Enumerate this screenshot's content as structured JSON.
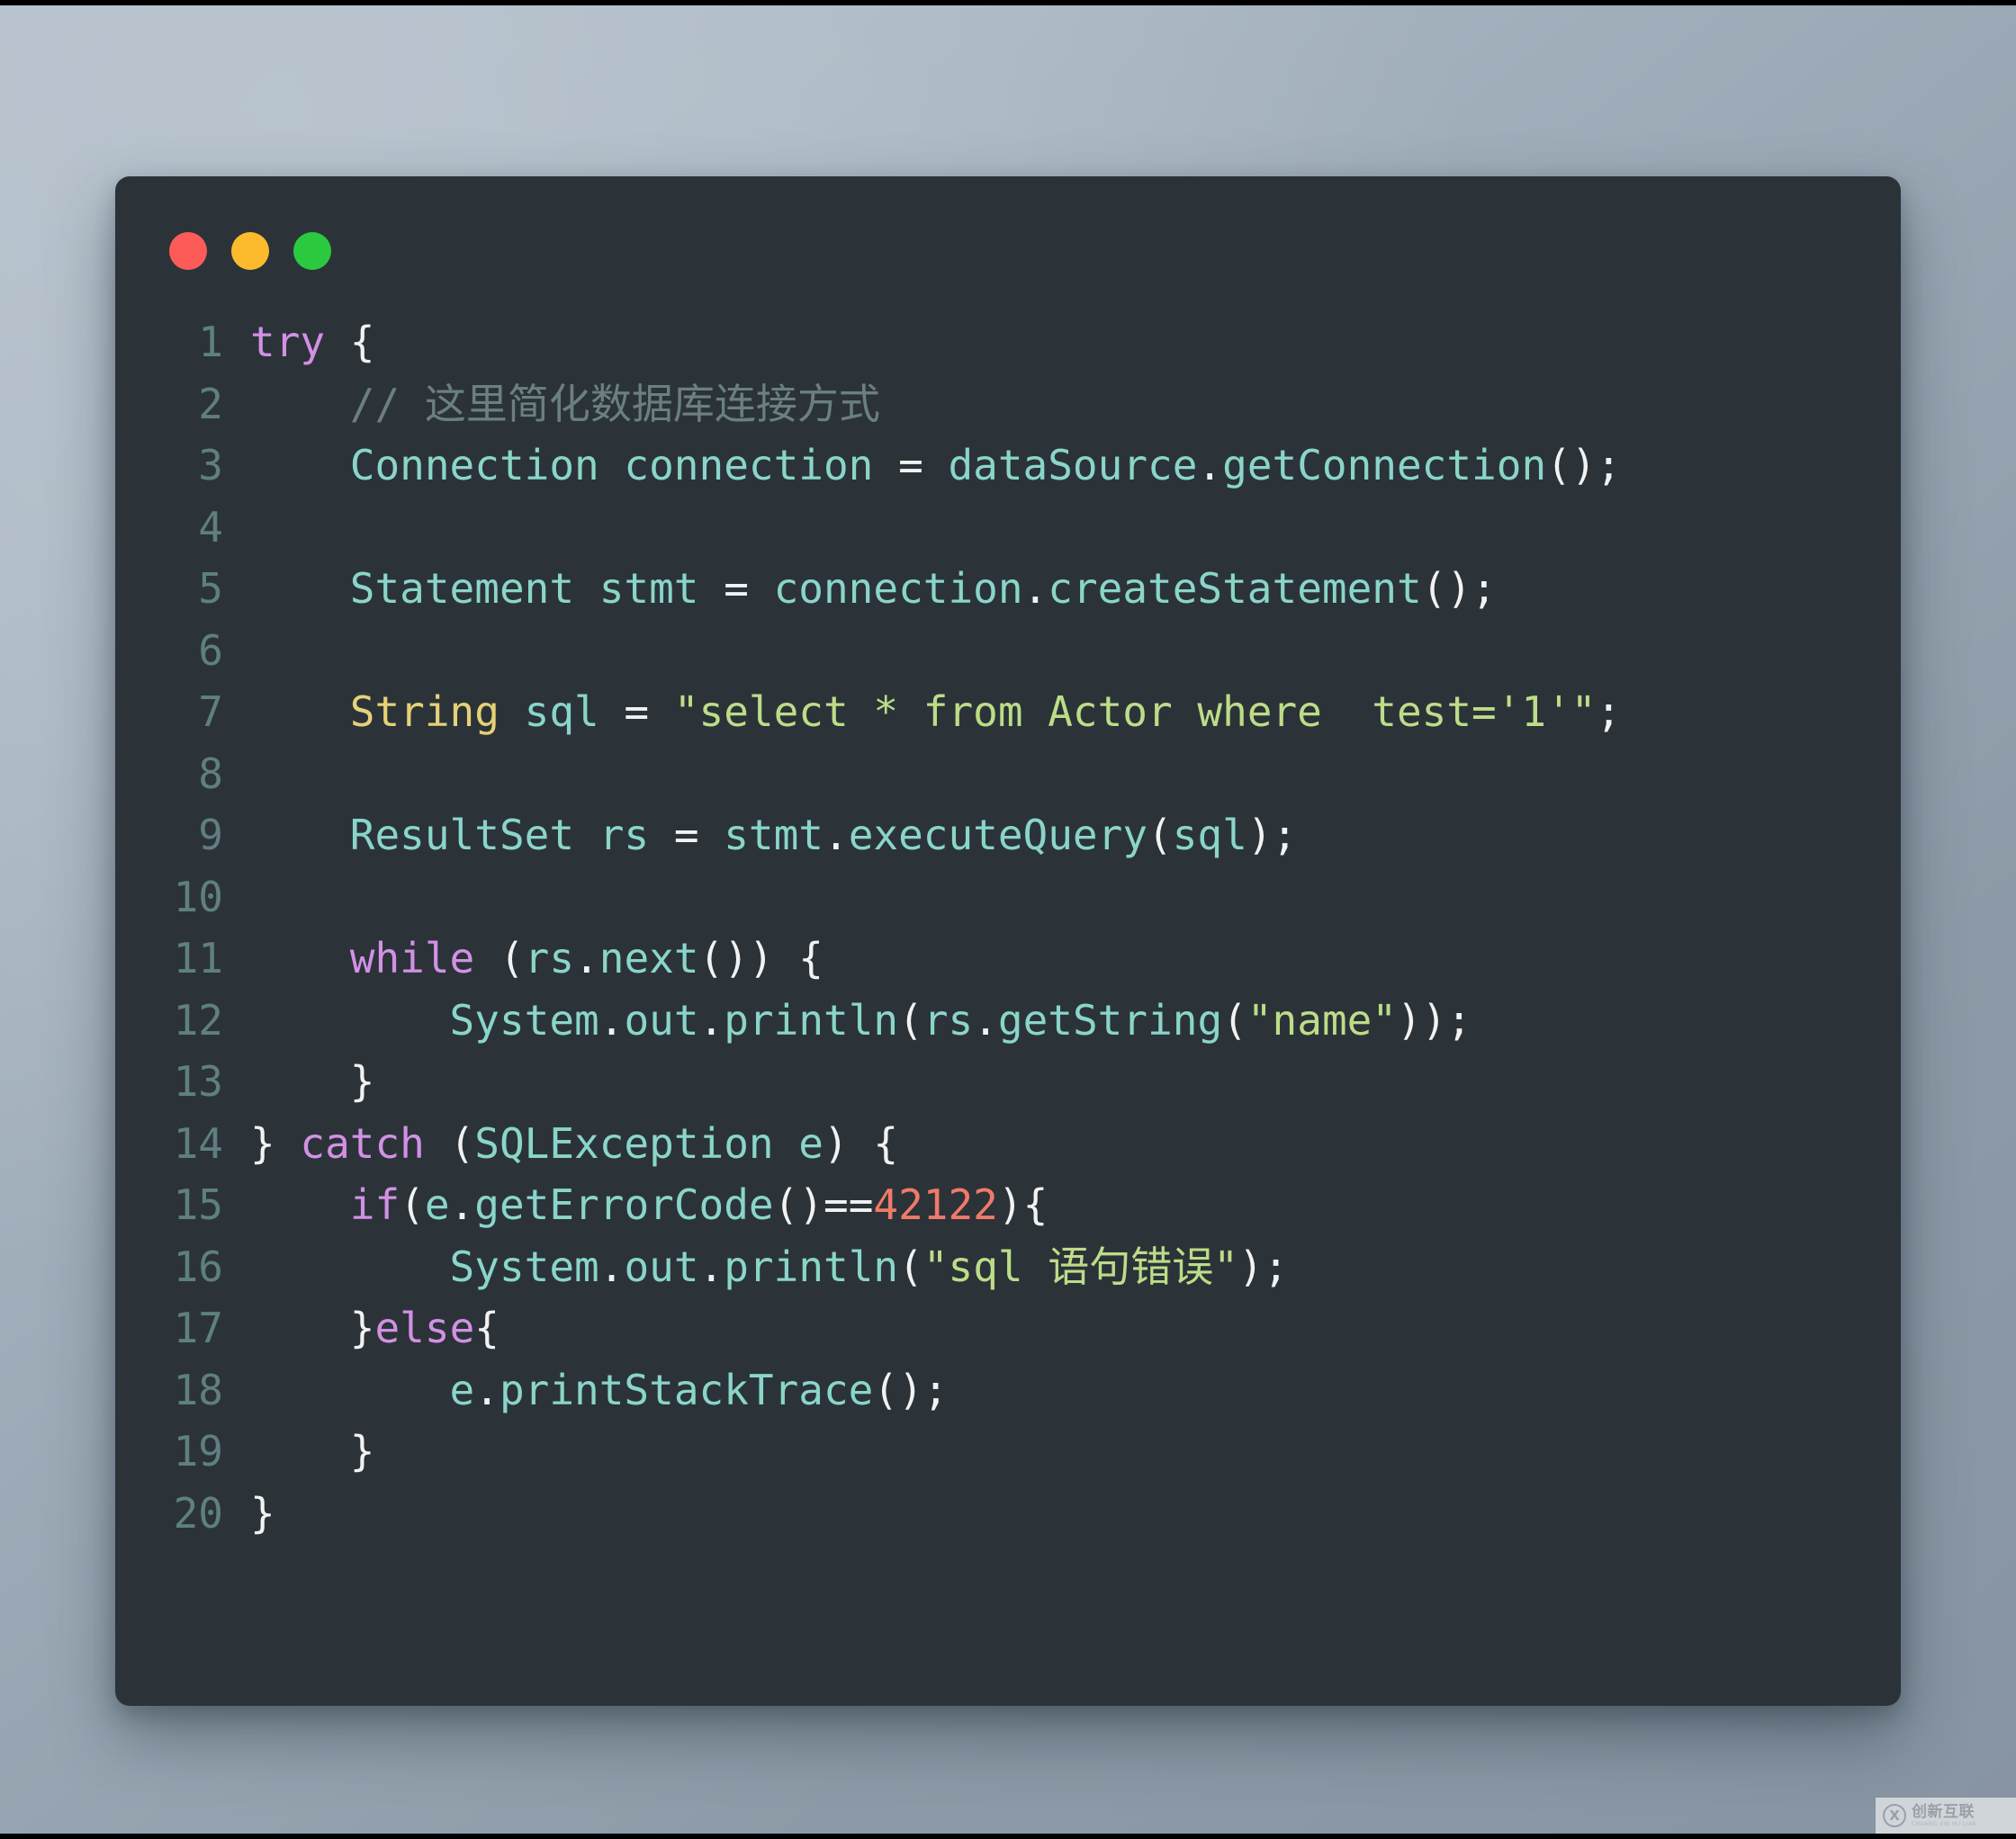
{
  "window": {
    "title": "",
    "traffic_lights": [
      {
        "name": "close",
        "color": "#fc5b57"
      },
      {
        "name": "minimize",
        "color": "#fcbb2d"
      },
      {
        "name": "maximize",
        "color": "#2bc93f"
      }
    ],
    "background": "#2b3339",
    "page_background": "#a0aeba"
  },
  "theme": {
    "plain": "#f2f2f2",
    "keyword": "#d291e4",
    "type": "#8ad5c9",
    "string": "#bddc88",
    "number": "#f07a6a",
    "comment": "#6b7f82",
    "yellow": "#e6d177",
    "line_number": "#5f7f80"
  },
  "code": {
    "language": "java",
    "line_numbers": [
      "1",
      "2",
      "3",
      "4",
      "5",
      "6",
      "7",
      "8",
      "9",
      "10",
      "11",
      "12",
      "13",
      "14",
      "15",
      "16",
      "17",
      "18",
      "19",
      "20"
    ],
    "lines": [
      {
        "n": "1",
        "text": "try {"
      },
      {
        "n": "2",
        "text": "    // 这里简化数据库连接方式"
      },
      {
        "n": "3",
        "text": "    Connection connection = dataSource.getConnection();"
      },
      {
        "n": "4",
        "text": ""
      },
      {
        "n": "5",
        "text": "    Statement stmt = connection.createStatement();"
      },
      {
        "n": "6",
        "text": ""
      },
      {
        "n": "7",
        "text": "    String sql = \"select * from Actor where  test='1'\";"
      },
      {
        "n": "8",
        "text": ""
      },
      {
        "n": "9",
        "text": "    ResultSet rs = stmt.executeQuery(sql);"
      },
      {
        "n": "10",
        "text": ""
      },
      {
        "n": "11",
        "text": "    while (rs.next()) {"
      },
      {
        "n": "12",
        "text": "        System.out.println(rs.getString(\"name\"));"
      },
      {
        "n": "13",
        "text": "    }"
      },
      {
        "n": "14",
        "text": "} catch (SQLException e) {"
      },
      {
        "n": "15",
        "text": "    if(e.getErrorCode()==42122){"
      },
      {
        "n": "16",
        "text": "        System.out.println(\"sql 语句错误\");"
      },
      {
        "n": "17",
        "text": "    }else{"
      },
      {
        "n": "18",
        "text": "        e.printStackTrace();"
      },
      {
        "n": "19",
        "text": "    }"
      },
      {
        "n": "20",
        "text": "}"
      }
    ]
  },
  "watermark": {
    "logo": "x-logo-icon",
    "name": "创新互联",
    "pinyin": "CHUANG XIN HU LIAN"
  }
}
